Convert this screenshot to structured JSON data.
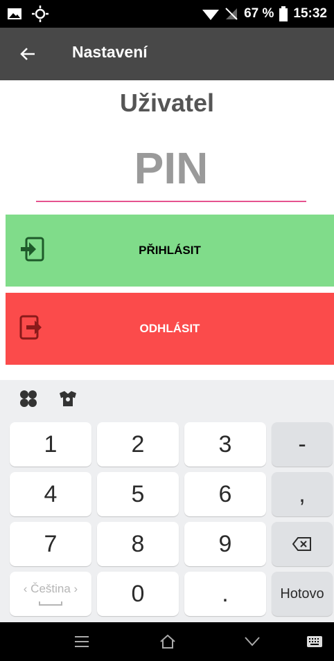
{
  "status_bar": {
    "battery_percent": "67 %",
    "time": "15:32",
    "icons": [
      "image-icon",
      "brightness-icon",
      "wifi-icon",
      "no-signal-icon",
      "battery-icon"
    ]
  },
  "app_bar": {
    "title": "Nastavení",
    "back_icon": "arrow-left-icon"
  },
  "main": {
    "user_title": "Uživatel",
    "pin_placeholder": "PIN",
    "pin_value": "",
    "underline_color": "#e5528f",
    "login_label": "PŘIHLÁSIT",
    "logout_label": "ODHLÁSIT",
    "login_color": "#80dc8a",
    "logout_color": "#fb4b4b"
  },
  "keyboard": {
    "tools": [
      "clover-icon",
      "shirt-icon"
    ],
    "keys": [
      "1",
      "2",
      "3",
      "-",
      "4",
      "5",
      "6",
      ",",
      "7",
      "8",
      "9",
      "0",
      "."
    ],
    "language": "Čeština",
    "done_label": "Hotovo",
    "backspace_icon": "backspace-icon"
  },
  "nav_bar": {
    "icons": [
      "menu-icon",
      "home-icon",
      "back-icon",
      "keyboard-icon"
    ]
  }
}
